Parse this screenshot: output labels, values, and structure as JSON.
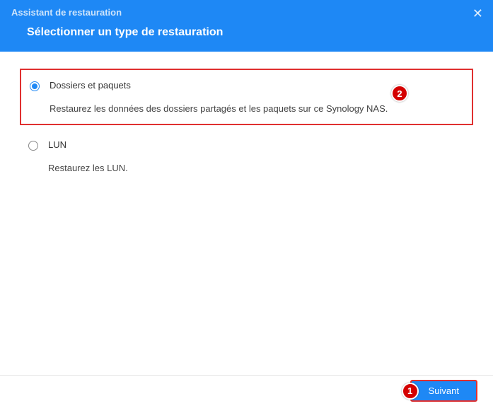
{
  "header": {
    "wizard_title": "Assistant de restauration",
    "step_title": "Sélectionner un type de restauration"
  },
  "options": [
    {
      "title": "Dossiers et paquets",
      "description": "Restaurez les données des dossiers partagés et les paquets sur ce Synology NAS.",
      "selected": true
    },
    {
      "title": "LUN",
      "description": "Restaurez les LUN.",
      "selected": false
    }
  ],
  "footer": {
    "next_label": "Suivant"
  },
  "callouts": {
    "one": "1",
    "two": "2"
  }
}
